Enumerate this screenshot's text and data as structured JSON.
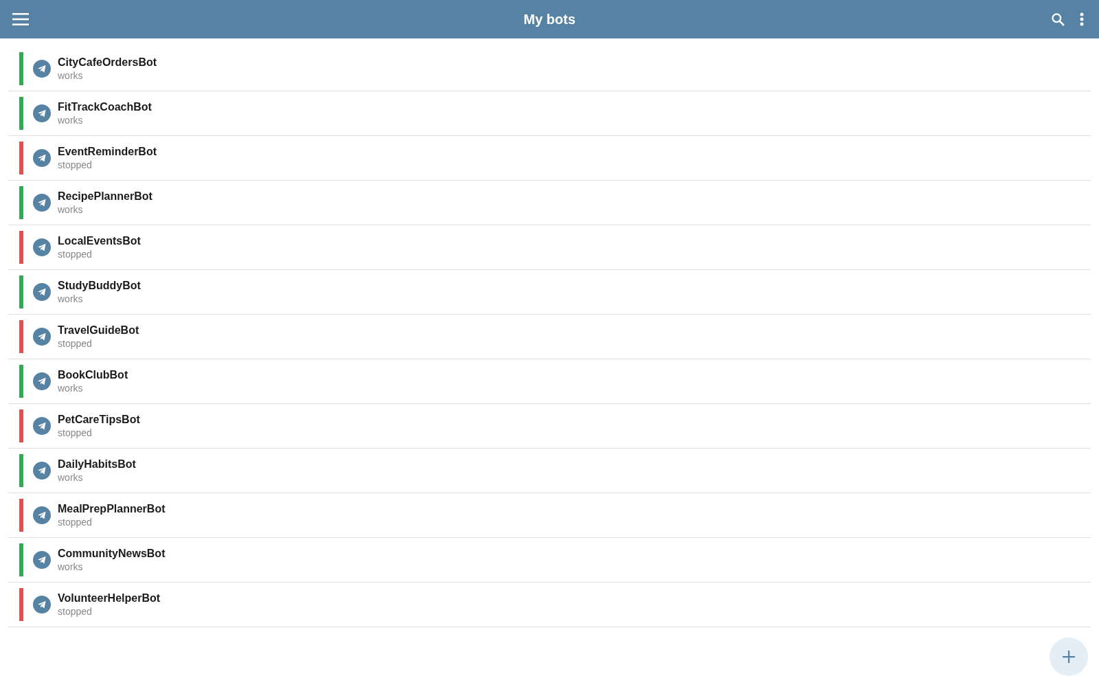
{
  "app_bar": {
    "title": "My bots"
  },
  "bots": [
    {
      "name": "CityCafeOrdersBot",
      "status": "works",
      "color": "#34a853"
    },
    {
      "name": "FitTrackCoachBot",
      "status": "works",
      "color": "#34a853"
    },
    {
      "name": "EventReminderBot",
      "status": "stopped",
      "color": "#d9534f"
    },
    {
      "name": "RecipePlannerBot",
      "status": "works",
      "color": "#34a853"
    },
    {
      "name": "LocalEventsBot",
      "status": "stopped",
      "color": "#d9534f"
    },
    {
      "name": "StudyBuddyBot",
      "status": "works",
      "color": "#34a853"
    },
    {
      "name": "TravelGuideBot",
      "status": "stopped",
      "color": "#d9534f"
    },
    {
      "name": "BookClubBot",
      "status": "works",
      "color": "#34a853"
    },
    {
      "name": "PetCareTipsBot",
      "status": "stopped",
      "color": "#d9534f"
    },
    {
      "name": "DailyHabitsBot",
      "status": "works",
      "color": "#34a853"
    },
    {
      "name": "MealPrepPlannerBot",
      "status": "stopped",
      "color": "#d9534f"
    },
    {
      "name": "CommunityNewsBot",
      "status": "works",
      "color": "#34a853"
    },
    {
      "name": "VolunteerHelperBot",
      "status": "stopped",
      "color": "#d9534f"
    }
  ]
}
